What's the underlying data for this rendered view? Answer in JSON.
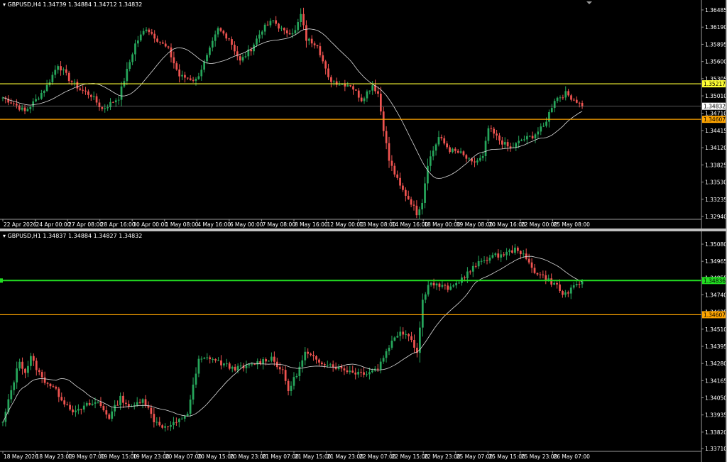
{
  "colors": {
    "bull": "#26a65b",
    "bear": "#ef5350",
    "ma": "#dcdcdc",
    "grid": "#4a4a4a"
  },
  "panes": [
    {
      "id": "top",
      "symbol_label": "GBPUSD,H4",
      "ohlc_label": "1.34739 1.34884 1.34712 1.34832",
      "yticks": [
        "1.36485",
        "1.36190",
        "1.35895",
        "1.35600",
        "1.35305",
        "1.35010",
        "1.34710",
        "1.34415",
        "1.34120",
        "1.33825",
        "1.33530",
        "1.33235",
        "1.32940"
      ],
      "ymin": 1.3294,
      "ymax": 1.36485,
      "xlabels": [
        "22 Apr 2026",
        "24 Apr 00:00",
        "27 Apr 08:00",
        "28 Apr 16:00",
        "30 Apr 00:00",
        "1 May 08:00",
        "4 May 16:00",
        "6 May 00:00",
        "7 May 08:00",
        "8 May 16:00",
        "12 May 00:00",
        "13 May 08:00",
        "14 May 16:00",
        "18 May 00:00",
        "19 May 08:00",
        "20 May 16:00",
        "22 May 00:00",
        "25 May 08:00"
      ],
      "hlines": [
        {
          "value": 1.35217,
          "label": "1.35217",
          "color": "#ffff33",
          "label_bg": "#ffff33",
          "label_fg": "#000"
        },
        {
          "value": 1.34832,
          "label": "1.34832",
          "color": "#888888",
          "label_bg": "#ffffff",
          "label_fg": "#000",
          "thin": true
        },
        {
          "value": 1.34607,
          "label": "1.34607",
          "color": "#ffa500",
          "label_bg": "#ffa500",
          "label_fg": "#000"
        }
      ],
      "anchors": [
        [
          0,
          1.3498
        ],
        [
          4,
          1.3488
        ],
        [
          8,
          1.3474
        ],
        [
          12,
          1.3494
        ],
        [
          16,
          1.3518
        ],
        [
          20,
          1.3555
        ],
        [
          24,
          1.353
        ],
        [
          28,
          1.3512
        ],
        [
          32,
          1.3502
        ],
        [
          36,
          1.3478
        ],
        [
          42,
          1.3498
        ],
        [
          48,
          1.359
        ],
        [
          52,
          1.3618
        ],
        [
          56,
          1.3598
        ],
        [
          60,
          1.358
        ],
        [
          64,
          1.3535
        ],
        [
          70,
          1.3528
        ],
        [
          74,
          1.3568
        ],
        [
          78,
          1.3615
        ],
        [
          82,
          1.36
        ],
        [
          86,
          1.356
        ],
        [
          90,
          1.3582
        ],
        [
          94,
          1.3615
        ],
        [
          98,
          1.363
        ],
        [
          102,
          1.361
        ],
        [
          106,
          1.3612
        ],
        [
          108,
          1.364
        ],
        [
          110,
          1.3598
        ],
        [
          114,
          1.359
        ],
        [
          118,
          1.353
        ],
        [
          122,
          1.3522
        ],
        [
          126,
          1.352
        ],
        [
          130,
          1.3495
        ],
        [
          134,
          1.352
        ],
        [
          136,
          1.3505
        ],
        [
          138,
          1.3445
        ],
        [
          140,
          1.339
        ],
        [
          144,
          1.3345
        ],
        [
          148,
          1.3318
        ],
        [
          150,
          1.33
        ],
        [
          152,
          1.332
        ],
        [
          154,
          1.3385
        ],
        [
          158,
          1.343
        ],
        [
          162,
          1.3408
        ],
        [
          166,
          1.3402
        ],
        [
          170,
          1.3385
        ],
        [
          174,
          1.3395
        ],
        [
          176,
          1.3445
        ],
        [
          180,
          1.3425
        ],
        [
          184,
          1.341
        ],
        [
          188,
          1.3425
        ],
        [
          192,
          1.3432
        ],
        [
          196,
          1.3448
        ],
        [
          200,
          1.3495
        ],
        [
          204,
          1.3505
        ],
        [
          208,
          1.3492
        ],
        [
          210,
          1.3483
        ]
      ],
      "ma_period": 20,
      "seed": 7,
      "vol": 0.0009
    },
    {
      "id": "bottom",
      "symbol_label": "GBPUSD,H1",
      "ohlc_label": "1.34837 1.34884 1.34827 1.34832",
      "yticks": [
        "1.35080",
        "1.34965",
        "1.34855",
        "1.34740",
        "1.34625",
        "1.34510",
        "1.34395",
        "1.34280",
        "1.34165",
        "1.34050",
        "1.33935",
        "1.33820",
        "1.33710"
      ],
      "ymin": 1.3371,
      "ymax": 1.3508,
      "xlabels": [
        "18 May 2026",
        "18 May 23:00",
        "19 May 07:00",
        "19 May 15:00",
        "19 May 23:00",
        "20 May 07:00",
        "20 May 15:00",
        "20 May 23:00",
        "21 May 07:00",
        "21 May 15:00",
        "21 May 23:00",
        "22 May 07:00",
        "22 May 15:00",
        "22 May 23:00",
        "25 May 07:00",
        "25 May 15:00",
        "25 May 23:00",
        "26 May 07:00"
      ],
      "hlines": [
        {
          "value": 1.34836,
          "label": "1.34836",
          "color": "#22dd22",
          "label_bg": "#22dd22",
          "label_fg": "#000",
          "thick": true
        },
        {
          "value": 1.34607,
          "label": "1.34607",
          "color": "#ffa500",
          "label_bg": "#ffa500",
          "label_fg": "#000"
        }
      ],
      "anchors": [
        [
          0,
          1.3388
        ],
        [
          3,
          1.341
        ],
        [
          6,
          1.343
        ],
        [
          8,
          1.3422
        ],
        [
          10,
          1.3432
        ],
        [
          14,
          1.3418
        ],
        [
          18,
          1.3412
        ],
        [
          22,
          1.3402
        ],
        [
          26,
          1.3395
        ],
        [
          30,
          1.34
        ],
        [
          34,
          1.3402
        ],
        [
          38,
          1.3392
        ],
        [
          42,
          1.3405
        ],
        [
          46,
          1.3398
        ],
        [
          50,
          1.3405
        ],
        [
          54,
          1.339
        ],
        [
          58,
          1.3385
        ],
        [
          62,
          1.3388
        ],
        [
          66,
          1.3395
        ],
        [
          70,
          1.343
        ],
        [
          74,
          1.3432
        ],
        [
          78,
          1.3428
        ],
        [
          82,
          1.3425
        ],
        [
          86,
          1.3425
        ],
        [
          90,
          1.3428
        ],
        [
          96,
          1.3432
        ],
        [
          100,
          1.3422
        ],
        [
          102,
          1.341
        ],
        [
          106,
          1.3425
        ],
        [
          108,
          1.3435
        ],
        [
          112,
          1.343
        ],
        [
          116,
          1.3428
        ],
        [
          120,
          1.3425
        ],
        [
          126,
          1.3422
        ],
        [
          130,
          1.3422
        ],
        [
          134,
          1.3425
        ],
        [
          138,
          1.344
        ],
        [
          142,
          1.345
        ],
        [
          144,
          1.3448
        ],
        [
          146,
          1.3445
        ],
        [
          148,
          1.3435
        ],
        [
          150,
          1.347
        ],
        [
          152,
          1.3482
        ],
        [
          156,
          1.348
        ],
        [
          160,
          1.3478
        ],
        [
          164,
          1.3485
        ],
        [
          168,
          1.3492
        ],
        [
          172,
          1.3498
        ],
        [
          176,
          1.35
        ],
        [
          180,
          1.3502
        ],
        [
          184,
          1.3505
        ],
        [
          188,
          1.3495
        ],
        [
          190,
          1.349
        ],
        [
          194,
          1.3485
        ],
        [
          198,
          1.348
        ],
        [
          200,
          1.3474
        ],
        [
          202,
          1.3476
        ],
        [
          205,
          1.348
        ],
        [
          207,
          1.3483
        ]
      ],
      "ma_period": 20,
      "seed": 13,
      "vol": 0.00035
    }
  ]
}
